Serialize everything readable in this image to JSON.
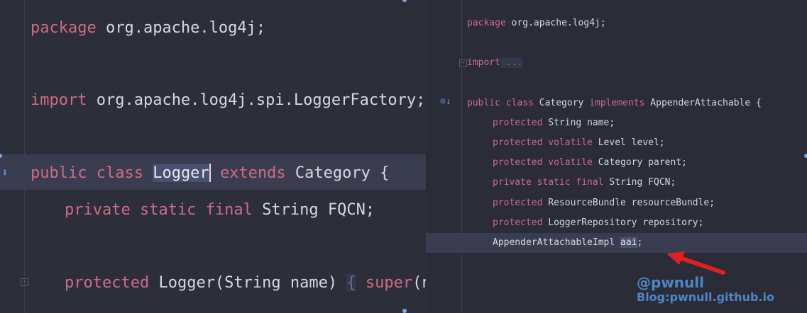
{
  "left_pane": {
    "line1": {
      "kw": "package",
      "rest": " org.apache.log4j;"
    },
    "line2": {
      "kw": "import",
      "rest": " org.apache.log4j.spi.LoggerFactory;"
    },
    "line3": {
      "kw1": "public class",
      "sel": "Logger",
      "kw2": "extends",
      "rest": " Category {"
    },
    "line4": {
      "kw": "private static final",
      "rest": " String FQCN;"
    },
    "line5": {
      "kw": "protected",
      "mid": " Logger(String name) ",
      "brace_open": "{",
      "kw2": "super",
      "rest": "(name);",
      "brace_close": "}"
    }
  },
  "right_pane": {
    "line1": {
      "kw": "package",
      "rest": " org.apache.log4j;"
    },
    "line2": {
      "kw": "import",
      "rest": " ..."
    },
    "line3": {
      "kw1": "public class",
      "mid": " Category ",
      "kw2": "implements",
      "rest": " AppenderAttachable {"
    },
    "fields": [
      {
        "kw": "protected",
        "rest": " String name;"
      },
      {
        "kw": "protected volatile",
        "rest": " Level level;"
      },
      {
        "kw": "protected volatile",
        "rest": " Category parent;"
      },
      {
        "kw": "private static final",
        "rest": " String FQCN;"
      },
      {
        "kw": "protected",
        "rest": " ResourceBundle resourceBundle;"
      },
      {
        "kw": "protected",
        "rest": " LoggerRepository repository;"
      }
    ],
    "last_line": {
      "type": "AppenderAttachableImpl ",
      "sel": "aai",
      "rest": ";"
    }
  },
  "watermark": {
    "line1": "@pwnull",
    "line2": "Blog:pwnull.github.io"
  },
  "colors": {
    "keyword": "#cf6a8a",
    "identifier": "#d7d7df",
    "background": "#2b2d38",
    "watermark": "#4f86c6",
    "arrow": "#e02020"
  }
}
